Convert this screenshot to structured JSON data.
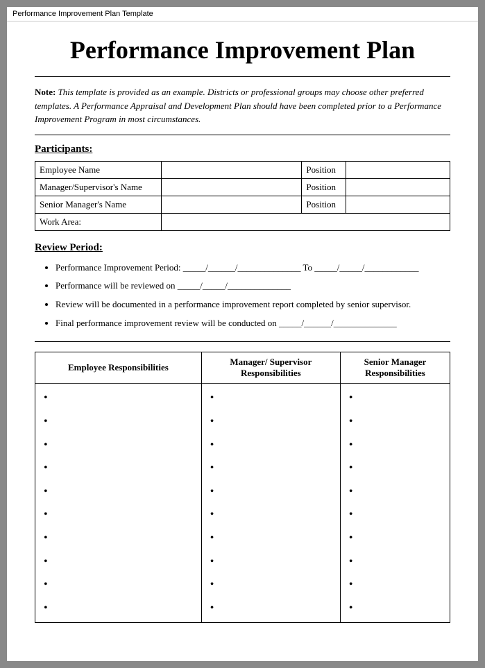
{
  "pageHeaderBar": {
    "title": "Performance Improvement Plan Template"
  },
  "mainTitle": "Performance Improvement Plan",
  "note": {
    "label": "Note:",
    "text": " This template is provided as an example. Districts or professional groups may choose other preferred templates. A Performance Appraisal and Development Plan should have been completed prior to a Performance Improvement Program in most circumstances."
  },
  "sections": {
    "participants": {
      "heading": "Participants:",
      "rows": [
        {
          "label": "Employee Name",
          "value": "",
          "posLabel": "Position",
          "posValue": ""
        },
        {
          "label": "Manager/Supervisor's Name",
          "value": "",
          "posLabel": "Position",
          "posValue": ""
        },
        {
          "label": "Senior Manager's Name",
          "value": "",
          "posLabel": "Position",
          "posValue": ""
        },
        {
          "label": "Work Area:",
          "value": "",
          "posLabel": null,
          "posValue": null
        }
      ]
    },
    "reviewPeriod": {
      "heading": "Review Period:",
      "bullets": [
        "Performance Improvement Period: _____/______/______________ To _____/_____/____________",
        "Performance will be reviewed on _____/_____/______________",
        "Review will be documented in a performance improvement report completed by senior supervisor.",
        "Final performance improvement review will be conducted on _____/______/______________"
      ]
    },
    "responsibilities": {
      "columns": [
        {
          "heading": "Employee Responsibilities",
          "bullets": 10
        },
        {
          "heading": "Manager/ Supervisor\nResponsibilities",
          "bullets": 10
        },
        {
          "heading": "Senior Manager\nResponsibilities",
          "bullets": 10
        }
      ]
    }
  }
}
